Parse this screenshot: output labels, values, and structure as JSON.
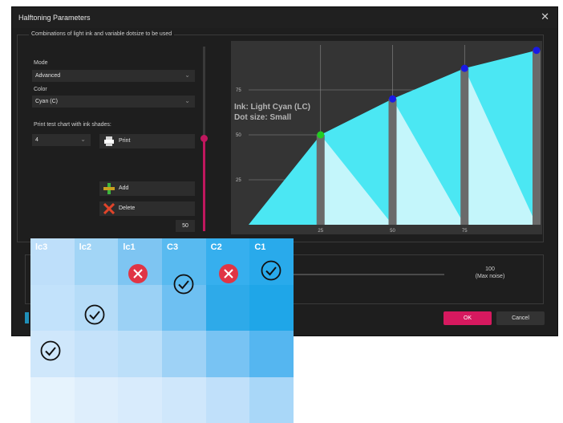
{
  "dialog": {
    "title": "Halftoning Parameters",
    "close_glyph": "✕",
    "group_title": "Combinations of light ink and variable dotsize to be used",
    "mode": {
      "label": "Mode",
      "value": "Advanced"
    },
    "color": {
      "label": "Color",
      "value": "Cyan (C)"
    },
    "test_chart": {
      "label": "Print test chart with ink shades:",
      "value": "4",
      "print_label": "Print"
    },
    "add_label": "Add",
    "delete_label": "Delete",
    "slider_value": "50",
    "tooltip": {
      "line1": "Ink: Light Cyan (LC)",
      "line2": "Dot size: Small"
    },
    "noise": {
      "value": "100",
      "caption": "(Max noise)"
    },
    "ok_label": "OK",
    "cancel_label": "Cancel"
  },
  "chart_data": {
    "type": "area",
    "xticks": [
      "25",
      "50",
      "75"
    ],
    "yticks": [
      "25",
      "50",
      "75"
    ],
    "xlim": [
      0,
      100
    ],
    "ylim": [
      0,
      100
    ],
    "grid": true,
    "curve": [
      [
        0,
        0
      ],
      [
        25,
        50
      ],
      [
        50,
        70
      ],
      [
        75,
        87
      ],
      [
        100,
        97
      ]
    ],
    "markers": [
      {
        "x": 25,
        "y": 50,
        "color": "#22cc22"
      },
      {
        "x": 50,
        "y": 70,
        "color": "#1a1ae6"
      },
      {
        "x": 75,
        "y": 87,
        "color": "#1a1ae6"
      },
      {
        "x": 100,
        "y": 97,
        "color": "#1a1ae6"
      }
    ],
    "colors": {
      "light": "#c4f6fb",
      "mid": "#6fe9f4",
      "dark": "#1fe5f2",
      "bar": "#6a6a6a",
      "background": "#343434",
      "gridline": "#8a8a8a"
    }
  },
  "palette": {
    "columns": [
      "lc3",
      "lc2",
      "lc1",
      "C3",
      "C2",
      "C1"
    ],
    "rows": [
      [
        "#bedffa",
        "#a2d5f6",
        "#7ec5f2",
        "#58baf0",
        "#36afee",
        "#29aaeb"
      ],
      [
        "#c2e2fb",
        "#b5dcf8",
        "#9bd1f5",
        "#6ec0f2",
        "#2eaae9",
        "#1fa6e8"
      ],
      [
        "#cfe7fb",
        "#c5e2fa",
        "#bcdff9",
        "#9ed2f6",
        "#78c3f3",
        "#55b6f0"
      ],
      [
        "#e6f3fd",
        "#deeefc",
        "#d8ebfc",
        "#cfe7fb",
        "#c0e0fa",
        "#a9d7f8"
      ]
    ],
    "marks": [
      {
        "row": 0,
        "col": 2,
        "kind": "cross"
      },
      {
        "row": 0,
        "col": 3,
        "kind": "check"
      },
      {
        "row": 0,
        "col": 4,
        "kind": "cross"
      },
      {
        "row": 0,
        "col": 5,
        "kind": "check"
      },
      {
        "row": 1,
        "col": 1,
        "kind": "check"
      },
      {
        "row": 2,
        "col": 0,
        "kind": "check"
      }
    ]
  }
}
